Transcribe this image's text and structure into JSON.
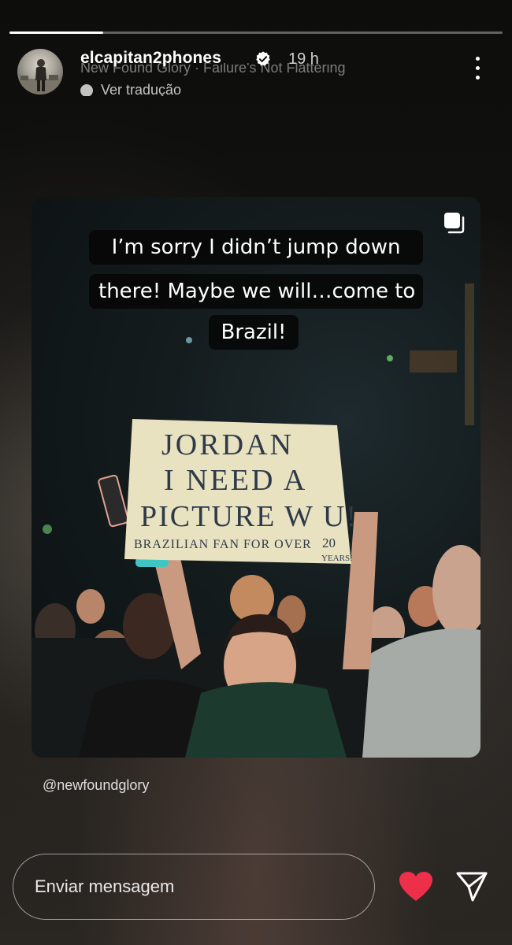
{
  "story": {
    "progress_fraction": 0.19
  },
  "header": {
    "username": "elcapitan2phones",
    "time_ago": "19 h",
    "music": "New Found Glory · Failure's Not Flattering",
    "translate_label": "Ver tradução"
  },
  "photo": {
    "sign_lines": [
      "JORDAN",
      "I NEED A",
      "PICTURE W U!"
    ],
    "sign_small": "BRAZILIAN FAN FOR OVER",
    "sign_years_num": "20",
    "sign_years_word": "YEARS!"
  },
  "caption": {
    "line1": "I’m sorry I didn’t jump down",
    "line2": "there! Maybe we will…come to",
    "line3": "Brazil!"
  },
  "mention": "@newfoundglory",
  "reply": {
    "placeholder": "Enviar mensagem"
  },
  "colors": {
    "heart": "#ed2f4a",
    "caption_bg": "#080808"
  },
  "icons": [
    "verified-badge-icon",
    "more-options-icon",
    "multi-post-icon",
    "heart-icon",
    "send-icon",
    "translate-icon"
  ]
}
